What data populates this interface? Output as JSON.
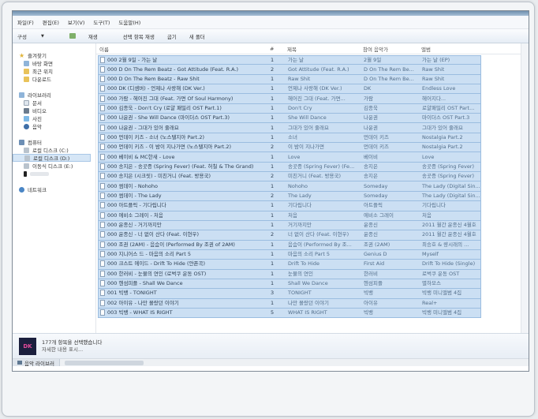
{
  "menu": [
    "파일(F)",
    "편집(E)",
    "보기(V)",
    "도구(T)",
    "도움말(H)"
  ],
  "toolbar": {
    "organize": "구성",
    "play": "재생",
    "share": "선택 항목 재생",
    "burn": "굽기",
    "new_folder": "새 폴더"
  },
  "nav": {
    "favorites": "즐겨찾기",
    "favorites_items": [
      "바탕 화면",
      "최근 위치",
      "다운로드"
    ],
    "libraries": "라이브러리",
    "libraries_items": [
      "문서",
      "비디오",
      "사진",
      "음악"
    ],
    "computer": "컴퓨터",
    "computer_items": [
      "로컬 디스크 (C:)",
      "로컬 디스크 (D:)",
      "이동식 디스크 (E:)"
    ],
    "network": "네트워크"
  },
  "columns": {
    "name": "이름",
    "num": "#",
    "title": "제목",
    "artist": "참여 음악가",
    "album": "앨범"
  },
  "rows": [
    {
      "name": "000 2월 9일 - 가는 날",
      "num": "1",
      "title": "가는 날",
      "artist": "2월 9일",
      "album": "가는 날 (EP)"
    },
    {
      "name": "000 D On The Rem Beatz - Got Attitude (Feat. R.A.)",
      "num": "2",
      "title": "Got Attitude (Feat. R.A.)",
      "artist": "D On The Rem Be...",
      "album": "Raw Shit"
    },
    {
      "name": "000 D On The Rem Beatz - Raw Shit",
      "num": "1",
      "title": "Raw Shit",
      "artist": "D On The Rem Be...",
      "album": "Raw Shit"
    },
    {
      "name": "000 DK (디셈버) - 언제나 사랑해 (DK Ver.)",
      "num": "1",
      "title": "언제나 사랑해 (DK Ver.)",
      "artist": "DK",
      "album": "Endless Love"
    },
    {
      "name": "000 가람 - 헤어진 그대 (Feat. 가면 Of Soul Harmony)",
      "num": "1",
      "title": "헤어진 그대 (Feat. 가면...",
      "artist": "가람",
      "album": "헤어지다..."
    },
    {
      "name": "000 김종욱 - Don't Cry (로얄 패밀리 OST Part.1)",
      "num": "1",
      "title": "Don't Cry",
      "artist": "김종욱",
      "album": "로얄패밀리 OST Part..."
    },
    {
      "name": "000 나윤권 - She Will Dance (마이더스 OST Part.3)",
      "num": "1",
      "title": "She Will Dance",
      "artist": "나윤권",
      "album": "마이더스 OST Part.3"
    },
    {
      "name": "000 나윤권 - 그대가 있어 줄래요",
      "num": "1",
      "title": "그대가 있어 줄래요",
      "artist": "나윤권",
      "album": "그대가 있어 줄래요"
    },
    {
      "name": "000 먼데이 키즈 - 소녀 (노스탤지아 Part.2)",
      "num": "1",
      "title": "소녀",
      "artist": "먼데이 키즈",
      "album": "Nostalgia Part.2"
    },
    {
      "name": "000 먼데이 키즈 - 이 밤이 지나가면 (노스탤지아 Part.2)",
      "num": "2",
      "title": "이 밤이 지나가면",
      "artist": "먼데이 키즈",
      "album": "Nostalgia Part.2"
    },
    {
      "name": "000 베이비 & MC한새 - Love",
      "num": "1",
      "title": "Love",
      "artist": "베이비",
      "album": "Love"
    },
    {
      "name": "000 송지은 - 송곳증 (Spring Fever) (Feat. 허칠 & The Grand)",
      "num": "1",
      "title": "송곳증 (Spring Fever) (Fe...",
      "artist": "송지은",
      "album": "송곳증 (Spring Fever)"
    },
    {
      "name": "000 송지은 (시크릿) - 미친거니 (Feat. 방용국)",
      "num": "2",
      "title": "미친거니 (Feat. 방용국)",
      "artist": "송지은",
      "album": "송곳증 (Spring Fever)"
    },
    {
      "name": "000 썸데이 - Nohoho",
      "num": "1",
      "title": "Nohoho",
      "artist": "Someday",
      "album": "The Lady (Digital Sin..."
    },
    {
      "name": "000 썸데이 - The Lady",
      "num": "2",
      "title": "The Lady",
      "artist": "Someday",
      "album": "The Lady (Digital Sin..."
    },
    {
      "name": "000 아트플릭 - 기다립니다",
      "num": "1",
      "title": "기다립니다",
      "artist": "아트플릭",
      "album": "기다립니다"
    },
    {
      "name": "000 에비소 그레이 - 처음",
      "num": "1",
      "title": "처음",
      "artist": "에비소 그레이",
      "album": "처음"
    },
    {
      "name": "000 윤종신 - 거기까지만",
      "num": "1",
      "title": "거기까지만",
      "artist": "윤종신",
      "album": "2011 월간 윤종신 4월호"
    },
    {
      "name": "000 윤종신 - 너 없이 산다 (Feat. 이현우)",
      "num": "2",
      "title": "너 없이 산다 (Feat. 이현우)",
      "artist": "윤종신",
      "album": "2011 월간 윤종신 4월호"
    },
    {
      "name": "000 조권 (2AM) - 음슴이 (Performed By 조권 of 2AM)",
      "num": "1",
      "title": "음슴이 (Performed By 조...",
      "artist": "조권 (2AM)",
      "album": "최승호 & 량시래의 ..."
    },
    {
      "name": "000 지니어스 드 - 마음의 소리 Part 5",
      "num": "1",
      "title": "마음의 소리 Part 5",
      "artist": "Genius D",
      "album": "Myself"
    },
    {
      "name": "000 크스트 에이드 - Drift To Hide (얀픈곡)",
      "num": "1",
      "title": "Drift To Hide",
      "artist": "First Aid",
      "album": "Drift To Hide (Single)"
    },
    {
      "name": "000 한러비 - 눈물의 연인 (로벅쿠 운동 OST)",
      "num": "1",
      "title": "눈물의 연인",
      "artist": "한러비",
      "album": "로벅쿠 운동 OST"
    },
    {
      "name": "000 헨섬피플 - Shall We Dance",
      "num": "1",
      "title": "Shall We Dance",
      "artist": "헨섬피플",
      "album": "별하모스"
    },
    {
      "name": "001 빅뱅 - TONIGHT",
      "num": "3",
      "title": "TONIGHT",
      "artist": "빅뱅",
      "album": "빅뱅 미니앨범 4집"
    },
    {
      "name": "002 아이유 - 나만 몰랐던 이야기",
      "num": "1",
      "title": "나만 몰랐던 이야기",
      "artist": "아이유",
      "album": "Real+"
    },
    {
      "name": "003 빅뱅 - WHAT IS RIGHT",
      "num": "5",
      "title": "WHAT IS RIGHT",
      "artist": "빅뱅",
      "album": "빅뱅 미니앨범 4집"
    }
  ],
  "status": {
    "thumb_text": "DK",
    "line1": "177개 항목을 선택했습니다",
    "line2": "자세한 내용 표시..."
  },
  "bottom_tab": "음악 라이브러",
  "colors": {
    "selection_fill": "#cbdff3",
    "selection_border": "#9bbde0"
  }
}
